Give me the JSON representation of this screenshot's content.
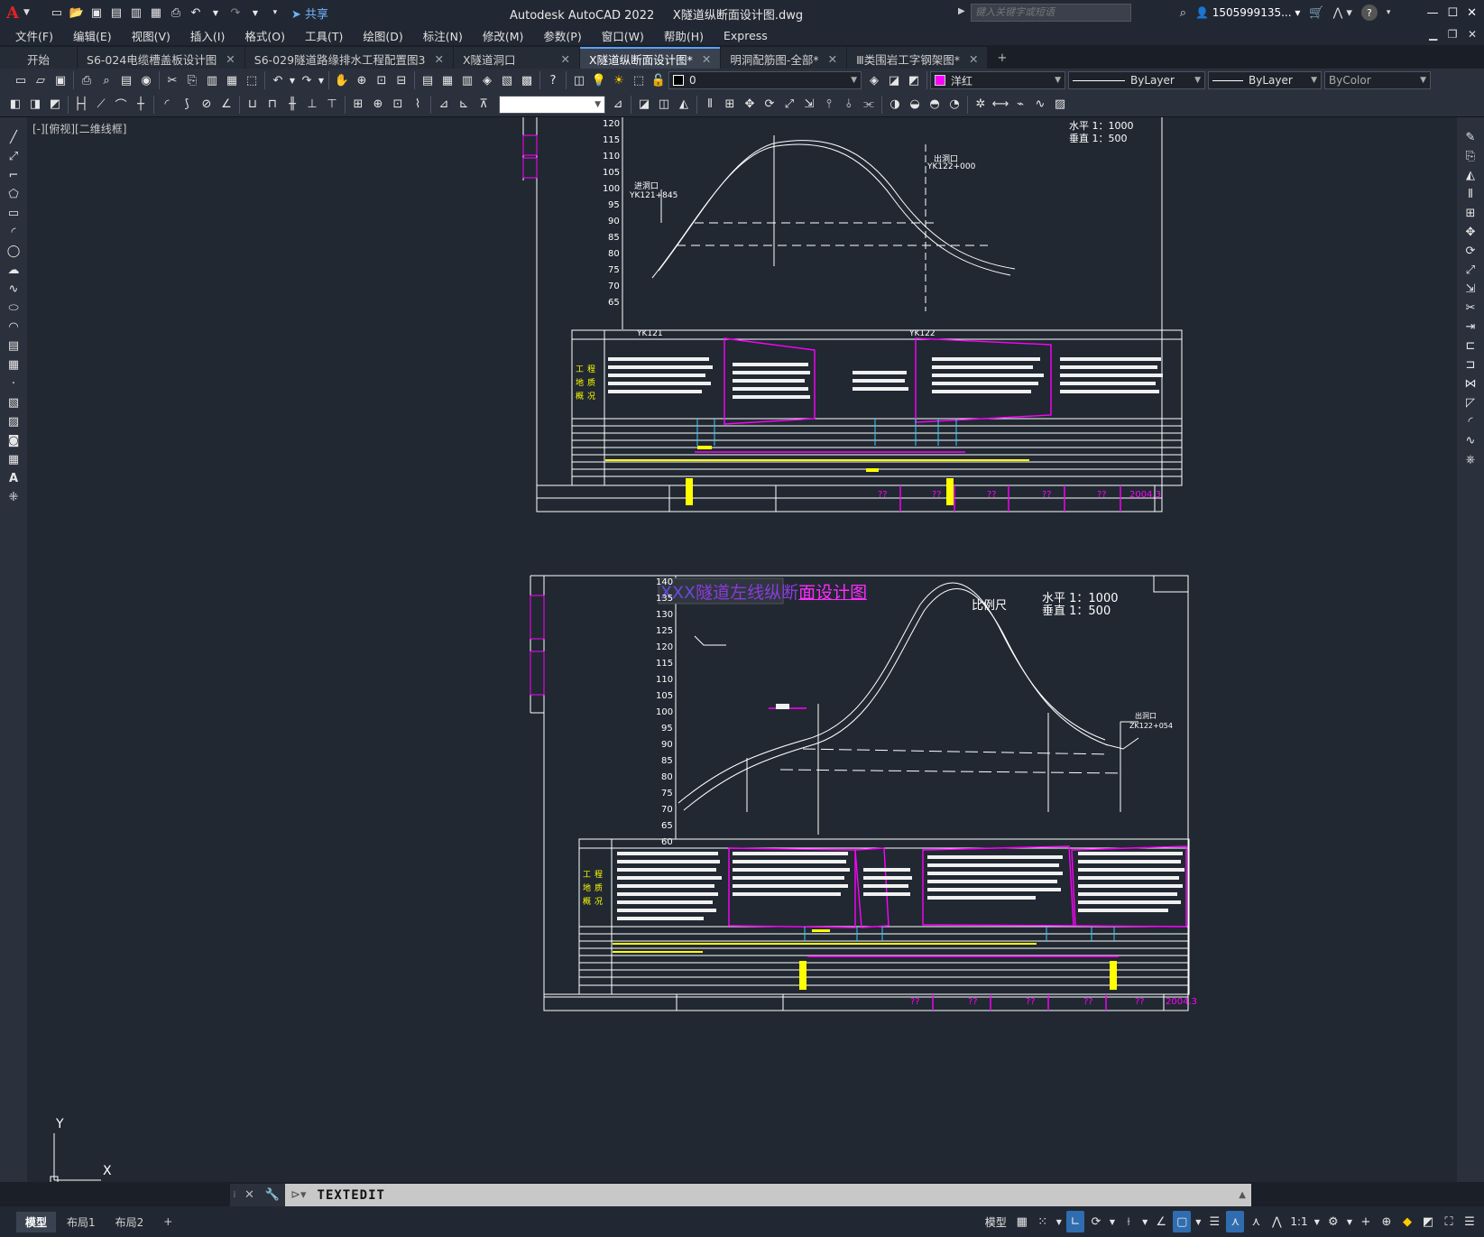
{
  "app": {
    "logo": "A",
    "title": "Autodesk AutoCAD 2022",
    "filename": "X隧道纵断面设计图.dwg",
    "share_label": "共享",
    "search_placeholder": "键入关键字或短语",
    "user": "1505999135...",
    "help": "?"
  },
  "menu": [
    "文件(F)",
    "编辑(E)",
    "视图(V)",
    "插入(I)",
    "格式(O)",
    "工具(T)",
    "绘图(D)",
    "标注(N)",
    "修改(M)",
    "参数(P)",
    "窗口(W)",
    "帮助(H)",
    "Express"
  ],
  "tabs": [
    {
      "label": "开始",
      "closable": false,
      "active": false
    },
    {
      "label": "S6-024电缆槽盖板设计图",
      "closable": true,
      "active": false
    },
    {
      "label": "S6-029隧道路缘排水工程配置图3",
      "closable": true,
      "active": false
    },
    {
      "label": "X隧道洞口",
      "closable": true,
      "active": false
    },
    {
      "label": "X隧道纵断面设计图*",
      "closable": true,
      "active": true
    },
    {
      "label": "明洞配筋图-全部*",
      "closable": true,
      "active": false
    },
    {
      "label": "Ⅲ类围岩工字钢架图*",
      "closable": true,
      "active": false
    }
  ],
  "properties": {
    "layer": "0",
    "color_name": "洋红",
    "color_hex": "#ff00ff",
    "linetype": "ByLayer",
    "lineweight": "ByLayer",
    "plotstyle": "ByColor"
  },
  "viewport": {
    "label": "[-][俯视][二维线框]"
  },
  "drawing": {
    "sheet1": {
      "scale_h": "水平  1：1000",
      "scale_v": "垂直  1：500",
      "elevations": [
        "120",
        "115",
        "110",
        "105",
        "100",
        "95",
        "90",
        "85",
        "80",
        "75",
        "70",
        "65"
      ],
      "entry_label": "进洞口",
      "entry_station": "YK121+845",
      "exit_label": "出洞口",
      "exit_station": "YK122+000",
      "station_a": "YK121",
      "station_b": "YK122",
      "row_labels": [
        "工程",
        "地质",
        "概况"
      ],
      "date": "2004.3",
      "marks": [
        "??",
        "??",
        "??",
        "??",
        "??"
      ]
    },
    "sheet2": {
      "title_prefix": "XXX",
      "title_main": "隧道左线纵断",
      "title_suffix": "面设计图",
      "scale_word": "比例尺",
      "scale_h": "水平  1：1000",
      "scale_v": "垂直  1：500",
      "elevations": [
        "140",
        "135",
        "130",
        "125",
        "120",
        "115",
        "110",
        "105",
        "100",
        "95",
        "90",
        "85",
        "80",
        "75",
        "70",
        "65",
        "60"
      ],
      "exit_label": "出洞口",
      "exit_station": "ZK122+054",
      "row_labels": [
        "工程",
        "地质",
        "概况"
      ],
      "date": "2004.3",
      "marks": [
        "??",
        "??",
        "??",
        "??",
        "??"
      ]
    }
  },
  "ucs": {
    "y": "Y",
    "x": "X"
  },
  "command": {
    "text": "TEXTEDIT"
  },
  "layout_tabs": [
    {
      "label": "模型",
      "active": true
    },
    {
      "label": "布局1",
      "active": false
    },
    {
      "label": "布局2",
      "active": false
    }
  ],
  "status": {
    "model_label": "模型",
    "scale": "1:1"
  }
}
